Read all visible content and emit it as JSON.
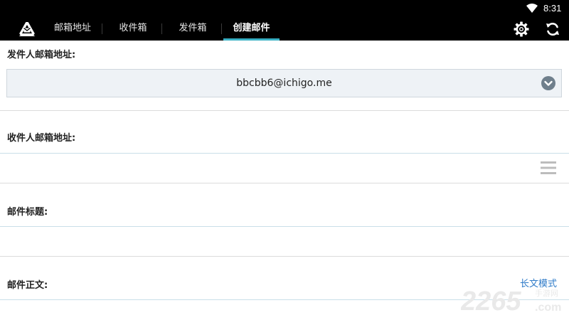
{
  "status_bar": {
    "time": "8:31"
  },
  "toolbar": {
    "tabs": [
      {
        "label": "邮箱地址",
        "active": false
      },
      {
        "label": "收件箱",
        "active": false
      },
      {
        "label": "发件箱",
        "active": false
      },
      {
        "label": "创建邮件",
        "active": true
      }
    ],
    "accent_color": "#39b0c4"
  },
  "form": {
    "sender_label": "发件人邮箱地址:",
    "sender_value": "bbcbb6@ichigo.me",
    "recipient_label": "收件人邮箱地址:",
    "recipient_value": "",
    "subject_label": "邮件标题:",
    "subject_value": "",
    "body_label": "邮件正文:",
    "body_value": "",
    "long_mode_link": "长文模式"
  },
  "watermark": {
    "text": "2265",
    "domain": ".com",
    "sub": "手游网"
  }
}
